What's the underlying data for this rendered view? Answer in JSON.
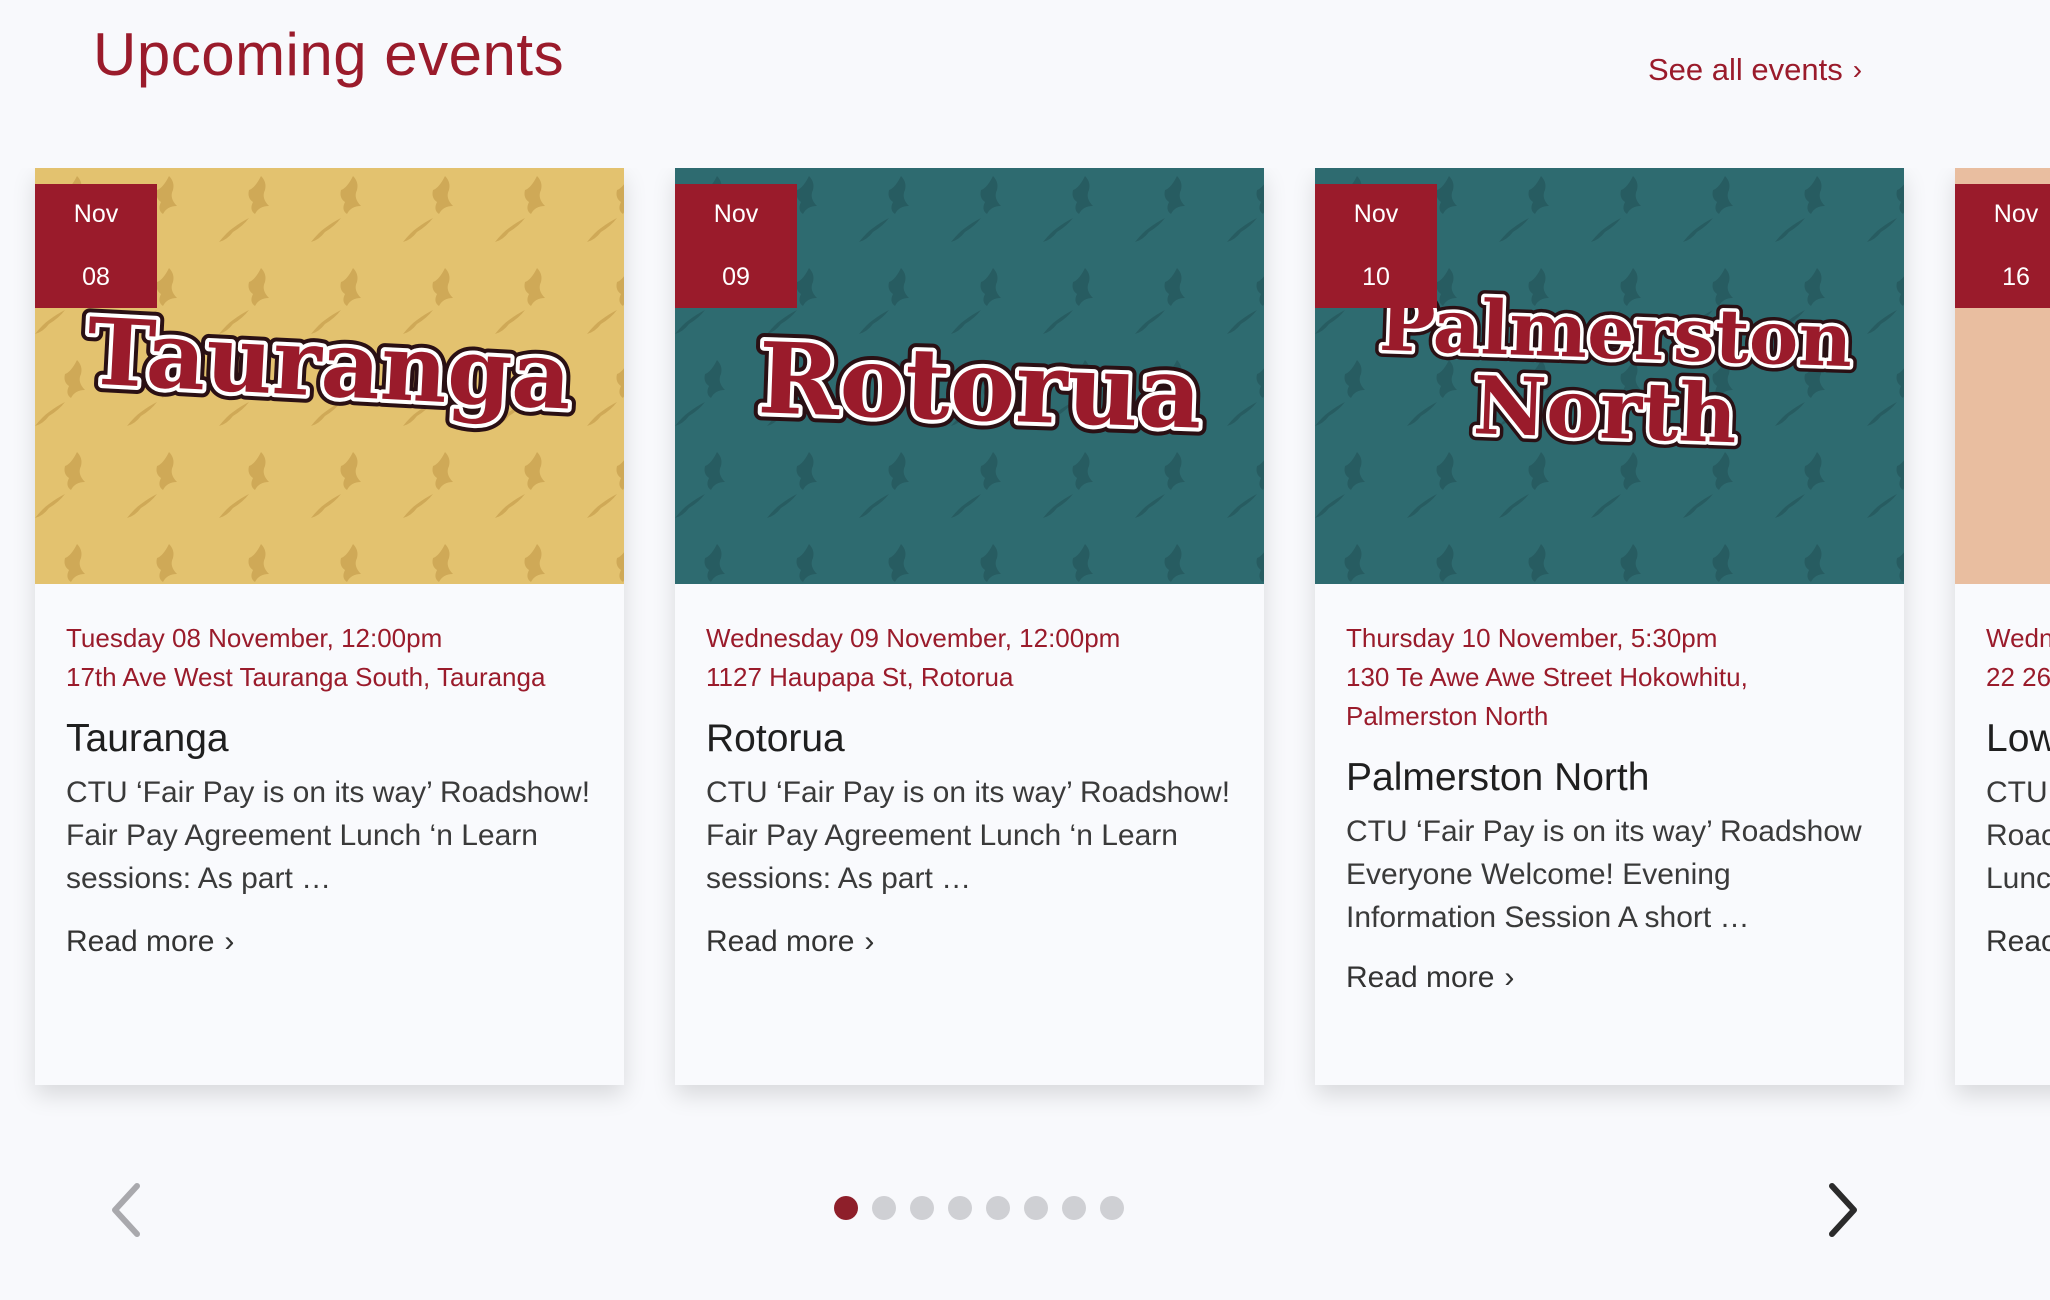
{
  "section": {
    "title": "Upcoming events",
    "see_all_label": "See all events"
  },
  "colors": {
    "brand": "#9a1b2b",
    "yellow_bg": "#e3c26f",
    "teal_bg": "#2e6b70",
    "peach_bg": "#e9bea0"
  },
  "cards": [
    {
      "month": "Nov",
      "day": "08",
      "image_text": "Tauranga",
      "date": "Tuesday 08 November, 12:00pm",
      "location": "17th Ave West Tauranga South, Tauranga",
      "title": "Tauranga",
      "description": "CTU ‘Fair Pay is on its way’ Roadshow! Fair Pay Agreement Lunch ‘n Learn sessions: As part …",
      "read_more": "Read more"
    },
    {
      "month": "Nov",
      "day": "09",
      "image_text": "Rotorua",
      "date": "Wednesday 09 November, 12:00pm",
      "location": "1127 Haupapa St, Rotorua",
      "title": "Rotorua",
      "description": "CTU ‘Fair Pay is on its way’ Roadshow! Fair Pay Agreement Lunch ‘n Learn sessions: As part …",
      "read_more": "Read more"
    },
    {
      "month": "Nov",
      "day": "10",
      "image_text_line1": "Palmerston",
      "image_text_line2": "North",
      "date": "Thursday 10 November, 5:30pm",
      "location": "130 Te Awe Awe Street Hokowhitu, Palmerston North",
      "title": "Palmerston North",
      "description": "CTU ‘Fair Pay is on its way’ Roadshow Everyone Welcome! Evening Information Session A short …",
      "read_more": "Read more"
    },
    {
      "month": "Nov",
      "day": "16",
      "date": "Wedn",
      "location": "22 26",
      "title": "Low",
      "description_lines": [
        "CTU",
        "Roac",
        "Lunc"
      ],
      "read_more": "Reac"
    }
  ],
  "carousel": {
    "dot_count": 8,
    "active_index": 0
  }
}
